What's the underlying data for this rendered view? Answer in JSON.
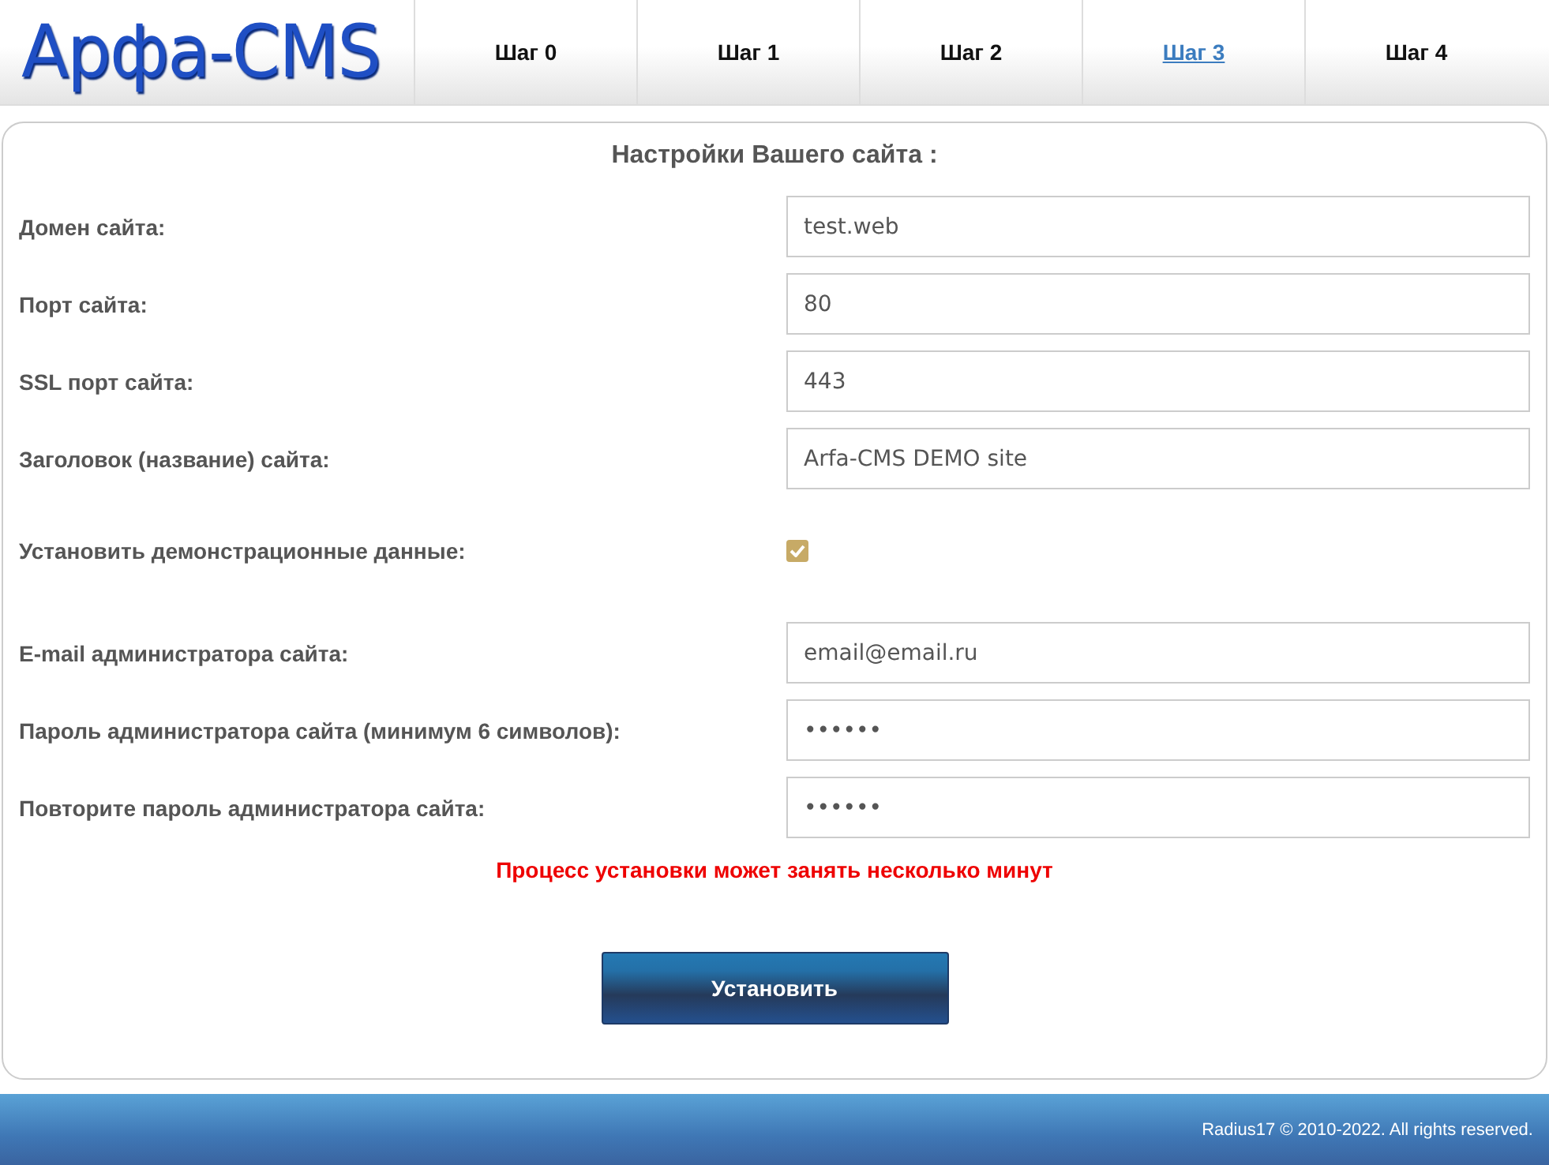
{
  "logo": "Арфа-CMS",
  "tabs": [
    {
      "label": "Шаг 0",
      "selected": false
    },
    {
      "label": "Шаг 1",
      "selected": false
    },
    {
      "label": "Шаг 2",
      "selected": false
    },
    {
      "label": "Шаг 3",
      "selected": true
    },
    {
      "label": "Шаг 4",
      "selected": false
    }
  ],
  "form": {
    "title": "Настройки Вашего сайта :",
    "fields": [
      {
        "kind": "text",
        "label": "Домен сайта:",
        "value": "test.web"
      },
      {
        "kind": "text",
        "label": "Порт сайта:",
        "value": "80"
      },
      {
        "kind": "text",
        "label": "SSL порт сайта:",
        "value": "443"
      },
      {
        "kind": "text",
        "label": "Заголовок (название) сайта:",
        "value": "Arfa-CMS DEMO site"
      },
      {
        "kind": "checkbox",
        "label": "Установить демонстрационные данные:",
        "checked": true
      },
      {
        "kind": "text",
        "label": "E-mail администратора сайта:",
        "value": "email@email.ru"
      },
      {
        "kind": "password",
        "label": "Пароль администратора сайта (минимум 6 символов):",
        "value": "••••••"
      },
      {
        "kind": "password",
        "label": "Повторите пароль администратора сайта:",
        "value": "••••••"
      }
    ],
    "warning": "Процесс установки может занять несколько минут",
    "submit": "Установить"
  },
  "footer": "Radius17 © 2010-2022. All rights reserved."
}
